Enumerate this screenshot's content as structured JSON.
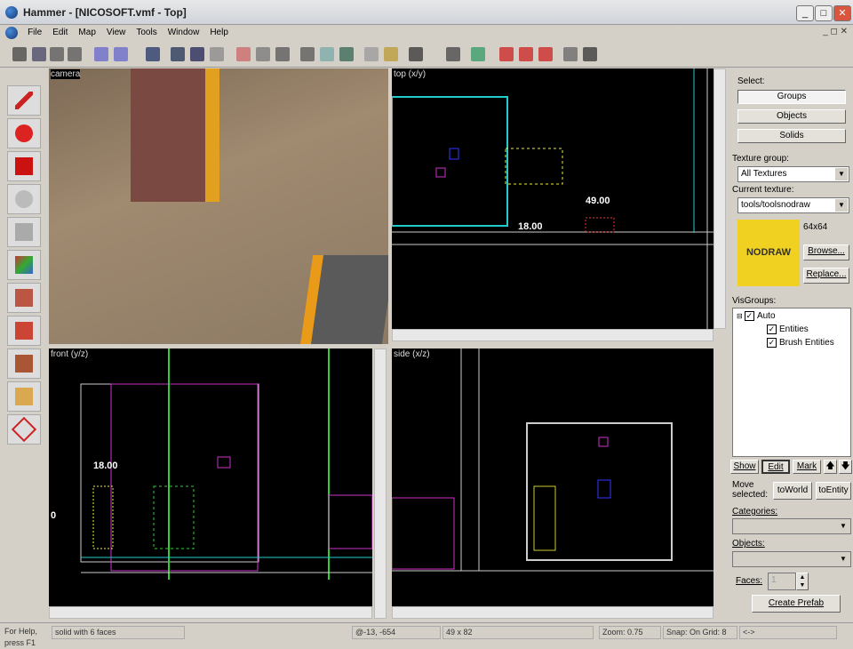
{
  "window": {
    "title": "Hammer - [NICOSOFT.vmf - Top]",
    "controls": [
      "_",
      "□",
      "✕"
    ]
  },
  "menu": [
    "File",
    "Edit",
    "Map",
    "View",
    "Tools",
    "Window",
    "Help"
  ],
  "viewports": {
    "camera": "camera",
    "top": "top (x/y)",
    "front": "front (y/z)",
    "side": "side (x/z)"
  },
  "dimensions": {
    "top_width": "49.00",
    "top_height": "18.00",
    "front_height": "18.00",
    "front_origin": "0"
  },
  "panel": {
    "select_label": "Select:",
    "groups": "Groups",
    "objects": "Objects",
    "solids": "Solids",
    "texture_group_label": "Texture group:",
    "texture_group": "All Textures",
    "current_texture_label": "Current texture:",
    "current_texture": "tools/toolsnodraw",
    "texture_preview": "NODRAW",
    "texture_size": "64x64",
    "browse": "Browse...",
    "replace": "Replace...",
    "visgroups_label": "VisGroups:",
    "visgroups": [
      {
        "label": "Auto",
        "checked": true
      },
      {
        "label": "Entities",
        "checked": true
      },
      {
        "label": "Brush Entities",
        "checked": true
      }
    ],
    "show": "Show",
    "edit": "Edit",
    "mark": "Mark",
    "up": "🡅",
    "down": "🡇",
    "move_selected": "Move selected:",
    "to_world": "toWorld",
    "to_entity": "toEntity",
    "categories_label": "Categories:",
    "objects_label": "Objects:",
    "faces_label": "Faces:",
    "faces_value": "1",
    "create_prefab": "Create Prefab"
  },
  "status": {
    "help": "For Help, press F1",
    "selection": "solid with 6 faces",
    "coords": "@-13, -654",
    "size": "49 x 82",
    "zoom": "Zoom: 0.75",
    "snap": "Snap: On Grid: 8",
    "extra": "<->"
  }
}
